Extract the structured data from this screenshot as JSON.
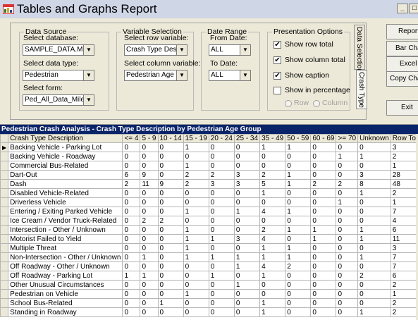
{
  "window": {
    "title": "Tables and Graphs Report",
    "min_label": "_",
    "max_label": "□"
  },
  "data_source": {
    "title": "Data Source",
    "database_label": "Select database:",
    "database_value": "SAMPLE_DATA.MDB",
    "datatype_label": "Select data type:",
    "datatype_value": "Pedestrian",
    "form_label": "Select form:",
    "form_value": "Ped_All_Data_Milepost"
  },
  "variable_selection": {
    "title": "Variable Selection",
    "row_label": "Select row variable:",
    "row_value": "Crash Type Description",
    "col_label": "Select column variable:",
    "col_value": "Pedestrian Age Group"
  },
  "date_range": {
    "title": "Date Range",
    "from_label": "From Date:",
    "from_value": "ALL",
    "to_label": "To Date:",
    "to_value": "ALL"
  },
  "presentation": {
    "title": "Presentation Options",
    "row_total": "Show row total",
    "column_total": "Show column total",
    "caption": "Show caption",
    "percentage": "Show in percentage",
    "radio_row": "Row",
    "radio_column": "Column"
  },
  "tabs": {
    "data_selection": "Data Selection",
    "crash_type": "Crash Type"
  },
  "buttons": {
    "report": "Report",
    "bar_chart": "Bar Chart",
    "excel": "Excel",
    "copy_chart": "Copy Chart",
    "exit": "Exit"
  },
  "grid": {
    "caption": "Pedestrian Crash Analysis - Crash Type Description by Pedestrian Age Group",
    "columns": [
      "Crash Type Description",
      "<= 4",
      "5 - 9",
      "10 - 14",
      "15 - 19",
      "20 - 24",
      "25 - 34",
      "35 - 49",
      "50 - 59",
      "60 - 69",
      ">= 70",
      "Unknown",
      "Row Total"
    ],
    "current_row_marker": "▶",
    "rows": [
      [
        "Backing Vehicle - Parking Lot",
        "0",
        "0",
        "0",
        "1",
        "0",
        "0",
        "1",
        "1",
        "0",
        "0",
        "0",
        "3"
      ],
      [
        "Backing Vehicle - Roadway",
        "0",
        "0",
        "0",
        "0",
        "0",
        "0",
        "0",
        "0",
        "0",
        "1",
        "1",
        "2"
      ],
      [
        "Commercial Bus-Related",
        "0",
        "0",
        "0",
        "1",
        "0",
        "0",
        "0",
        "0",
        "0",
        "0",
        "0",
        "1"
      ],
      [
        "Dart-Out",
        "6",
        "9",
        "0",
        "2",
        "2",
        "3",
        "2",
        "1",
        "0",
        "0",
        "3",
        "28"
      ],
      [
        "Dash",
        "2",
        "11",
        "9",
        "2",
        "3",
        "3",
        "5",
        "1",
        "2",
        "2",
        "8",
        "48"
      ],
      [
        "Disabled Vehicle-Related",
        "0",
        "0",
        "0",
        "0",
        "0",
        "0",
        "1",
        "0",
        "0",
        "0",
        "1",
        "2"
      ],
      [
        "Driverless Vehicle",
        "0",
        "0",
        "0",
        "0",
        "0",
        "0",
        "0",
        "0",
        "0",
        "1",
        "0",
        "1"
      ],
      [
        "Entering / Exiting Parked Vehicle",
        "0",
        "0",
        "0",
        "1",
        "0",
        "1",
        "4",
        "1",
        "0",
        "0",
        "0",
        "7"
      ],
      [
        "Ice Cream / Vendor Truck-Related",
        "0",
        "2",
        "2",
        "0",
        "0",
        "0",
        "0",
        "0",
        "0",
        "0",
        "0",
        "4"
      ],
      [
        "Intersection - Other / Unknown",
        "0",
        "0",
        "0",
        "1",
        "0",
        "0",
        "2",
        "1",
        "1",
        "0",
        "1",
        "6"
      ],
      [
        "Motorist Failed to Yield",
        "0",
        "0",
        "0",
        "1",
        "1",
        "3",
        "4",
        "0",
        "1",
        "0",
        "1",
        "11"
      ],
      [
        "Multiple Threat",
        "0",
        "0",
        "0",
        "1",
        "0",
        "0",
        "1",
        "1",
        "0",
        "0",
        "0",
        "3"
      ],
      [
        "Non-Intersection - Other / Unknown",
        "0",
        "1",
        "0",
        "1",
        "1",
        "1",
        "1",
        "1",
        "0",
        "0",
        "1",
        "7"
      ],
      [
        "Off Roadway - Other / Unknown",
        "0",
        "0",
        "0",
        "0",
        "0",
        "1",
        "4",
        "2",
        "0",
        "0",
        "0",
        "7"
      ],
      [
        "Off Roadway - Parking Lot",
        "1",
        "1",
        "0",
        "0",
        "1",
        "0",
        "1",
        "0",
        "0",
        "0",
        "2",
        "6"
      ],
      [
        "Other Unusual Circumstances",
        "0",
        "0",
        "0",
        "0",
        "0",
        "1",
        "0",
        "0",
        "0",
        "0",
        "0",
        "2"
      ],
      [
        "Pedestrian on Vehicle",
        "0",
        "0",
        "0",
        "1",
        "0",
        "0",
        "0",
        "0",
        "0",
        "0",
        "0",
        "1"
      ],
      [
        "School Bus-Related",
        "0",
        "0",
        "1",
        "0",
        "0",
        "0",
        "1",
        "0",
        "0",
        "0",
        "0",
        "2"
      ],
      [
        "Standing in Roadway",
        "0",
        "0",
        "0",
        "0",
        "0",
        "0",
        "1",
        "0",
        "0",
        "0",
        "1",
        "2"
      ]
    ]
  }
}
